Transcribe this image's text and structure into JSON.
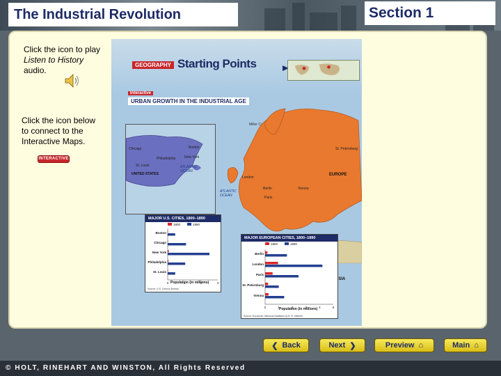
{
  "header": {
    "title": "The Industrial Revolution",
    "section": "Section 1"
  },
  "panel": {
    "audio_line1": "Click the icon to play",
    "audio_line2": "Listen to History",
    "audio_line3": "audio.",
    "maps_line1": "Click the icon below",
    "maps_line2": "to connect to the",
    "maps_line3": "Interactive Maps.",
    "interactive_button": "INTERACTIVE"
  },
  "map": {
    "geography_label": "GEOGRAPHY",
    "starting_points": "Starting Points",
    "interactive_tag": "Interactive",
    "subtitle": "URBAN GROWTH IN THE INDUSTRIAL AGE",
    "legend_text": "Miller Cylindrical projection",
    "inset_labels": {
      "chicago": "Chicago",
      "boston": "Boston",
      "new_york": "New York",
      "philadelphia": "Philadelphia",
      "st_louis": "St. Louis",
      "united_states": "UNITED STATES",
      "atlantic_ocean": "ATLANTIC OCEAN"
    },
    "europe_labels": {
      "st_petersburg": "St. Petersburg",
      "europe": "EUROPE",
      "london": "London",
      "berlin": "Berlin",
      "paris": "Paris",
      "vienna": "Vienna",
      "atlantic": "ATLANTIC OCEAN",
      "asia": "ASIA"
    }
  },
  "us_graph": {
    "title": "MAJOR U.S. CITIES, 1800–1890",
    "legend_1800": "1800",
    "legend_1890": "1890",
    "cities": [
      "Boston",
      "Chicago",
      "New York",
      "Philadelphia",
      "St. Louis"
    ],
    "values_1800": [
      0.02,
      0.0,
      0.06,
      0.04,
      0.0
    ],
    "values_1890": [
      0.45,
      1.1,
      2.5,
      1.05,
      0.45
    ],
    "ticks": [
      "0",
      "1",
      "2",
      "3"
    ],
    "xlabel": "Population (in millions)",
    "source": "Source: U.S. Census Bureau"
  },
  "eu_graph": {
    "title": "MAJOR EUROPEAN CITIES, 1800–1890",
    "legend_1800": "1800",
    "legend_1890": "1890",
    "cities": [
      "Berlin",
      "London",
      "Paris",
      "St. Petersburg",
      "Vienna"
    ],
    "values_1800": [
      0.17,
      0.95,
      0.55,
      0.22,
      0.25
    ],
    "values_1890": [
      1.6,
      4.2,
      2.45,
      1.0,
      1.4
    ],
    "ticks": [
      "0",
      "1",
      "2",
      "3",
      "4",
      "5"
    ],
    "xlabel": "Population (in millions)",
    "source": "Source: European Historical Statistics by B. R. Mitchell"
  },
  "nav": {
    "back": "Back",
    "next": "Next",
    "preview": "Preview",
    "main": "Main"
  },
  "footer": {
    "copyright": "© HOLT, RINEHART AND WINSTON, All Rights Reserved"
  },
  "colors": {
    "title_blue": "#1d2b66",
    "europe_orange": "#e8792f",
    "us_purple": "#6b6fbf",
    "bar_1800": "#d9262b",
    "bar_1890": "#24408f",
    "nav_yellow": "#e8d23a"
  }
}
